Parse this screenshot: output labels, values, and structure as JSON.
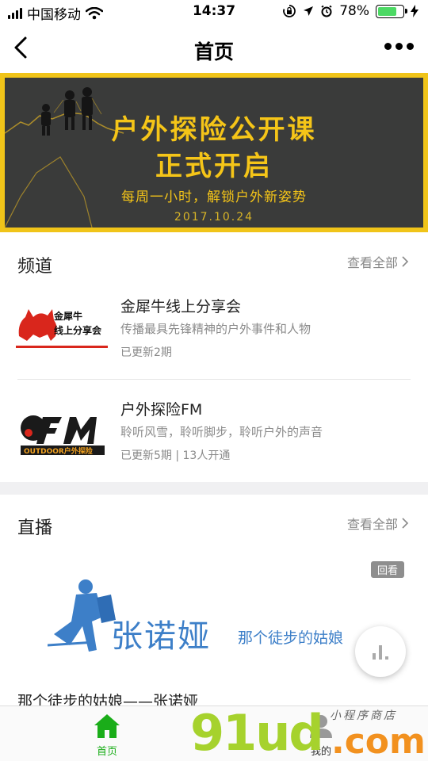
{
  "status_bar": {
    "carrier": "中国移动",
    "time": "14:37",
    "battery_percent": "78%",
    "battery_level": 0.78,
    "battery_color": "#4cd964"
  },
  "nav": {
    "title": "首页",
    "back_icon": "chevron-left-icon",
    "more_icon": "more-dots-icon"
  },
  "banner": {
    "title_line1": "户外探险公开课",
    "title_line2": "正式开启",
    "subtitle": "每周一小时，解锁户外新姿势",
    "date": "2017.10.24",
    "accent_color": "#f0c419"
  },
  "channels": {
    "section_title": "频道",
    "see_all": "查看全部",
    "items": [
      {
        "logo_text_1": "金犀牛",
        "logo_text_2": "线上分享会",
        "name": "金犀牛线上分享会",
        "desc": "传播最具先锋精神的户外事件和人物",
        "meta": "已更新2期"
      },
      {
        "logo_text_1": "FM",
        "logo_text_2": "OUTDOOR户外探险",
        "name": "户外探险FM",
        "desc": "聆听风雪，聆听脚步，聆听户外的声音",
        "meta": "已更新5期 | 13人开通"
      }
    ]
  },
  "live": {
    "section_title": "直播",
    "see_all": "查看全部",
    "badge": "回看",
    "cover_name": "张诺娅",
    "cover_slogan": "那个徒步的姑娘",
    "title": "那个徒步的姑娘——张诺娅"
  },
  "tab_bar": {
    "home_label": "首页",
    "mine_label": "我的",
    "active_color": "#1aad19"
  },
  "watermark": {
    "main": "91ud",
    "suffix": ".com",
    "tag": "小程序商店"
  }
}
